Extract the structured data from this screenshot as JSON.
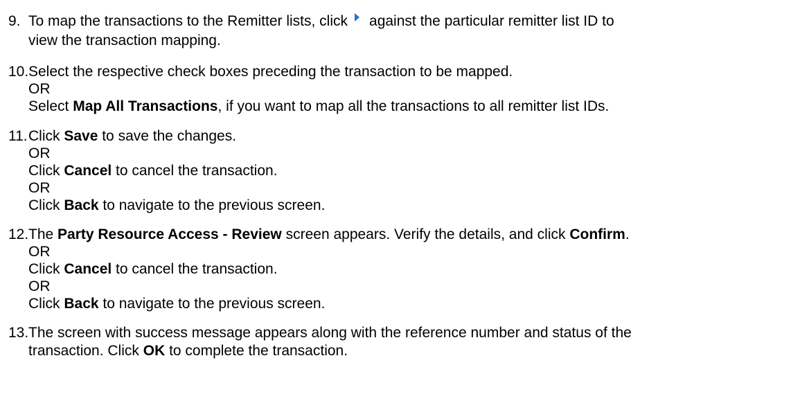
{
  "steps": [
    {
      "num": "9.",
      "l1a": "To map the transactions to the Remitter lists, click",
      "l1b": "against the particular remitter list ID to",
      "l2": "view the transaction mapping."
    },
    {
      "num": "10.",
      "l1": "Select the respective check boxes preceding the transaction to be mapped.",
      "or": "OR",
      "l3a": "Select ",
      "l3b": "Map All Transactions",
      "l3c": ", if you want to map all the transactions to all remitter list IDs."
    },
    {
      "num": "11.",
      "l1a": "Click ",
      "l1b": "Save",
      "l1c": " to save the changes.",
      "or1": "OR",
      "l3a": "Click ",
      "l3b": "Cancel",
      "l3c": " to cancel the transaction.",
      "or2": "OR",
      "l5a": "Click ",
      "l5b": "Back",
      "l5c": " to navigate to the previous screen."
    },
    {
      "num": "12.",
      "l1a": "The ",
      "l1b": "Party Resource Access - Review",
      "l1c": " screen appears. Verify the details, and click ",
      "l1d": "Confirm",
      "l1e": ".",
      "or1": "OR",
      "l3a": "Click ",
      "l3b": "Cancel",
      "l3c": " to cancel the transaction.",
      "or2": "OR",
      "l5a": "Click ",
      "l5b": "Back",
      "l5c": " to navigate to the previous screen."
    },
    {
      "num": "13.",
      "l1": "The screen with success message appears along with the reference number and status of the",
      "l2a": "transaction. Click ",
      "l2b": "OK",
      "l2c": " to complete the transaction."
    }
  ]
}
